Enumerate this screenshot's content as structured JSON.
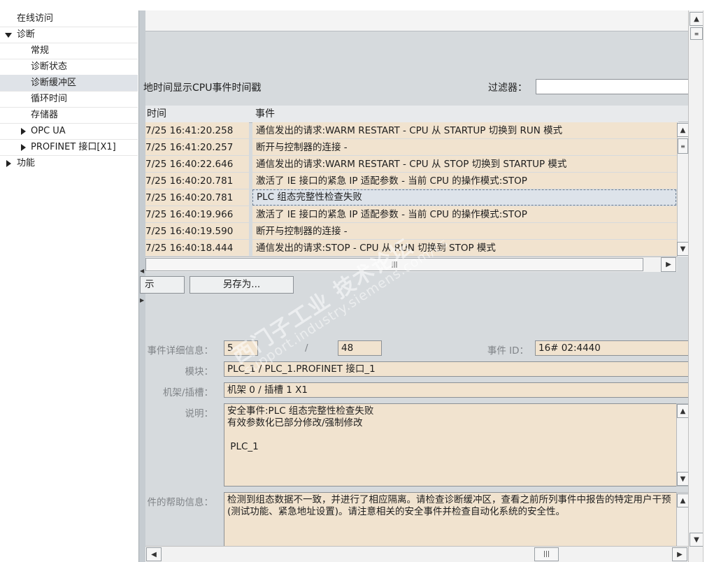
{
  "nav": {
    "items": [
      {
        "label": "在线访问",
        "level": 0,
        "expander": "none"
      },
      {
        "label": "诊断",
        "level": 0,
        "expander": "expanded"
      },
      {
        "label": "常规",
        "level": 1,
        "expander": "none"
      },
      {
        "label": "诊断状态",
        "level": 1,
        "expander": "none"
      },
      {
        "label": "诊断缓冲区",
        "level": 1,
        "expander": "none",
        "selected": true
      },
      {
        "label": "循环时间",
        "level": 1,
        "expander": "none"
      },
      {
        "label": "存储器",
        "level": 1,
        "expander": "none"
      },
      {
        "label": "OPC UA",
        "level": 1,
        "expander": "collapsed"
      },
      {
        "label": "PROFINET 接口[X1]",
        "level": 1,
        "expander": "collapsed"
      },
      {
        "label": "功能",
        "level": 0,
        "expander": "collapsed"
      }
    ]
  },
  "events": {
    "checkbox_text": "地时间显示CPU事件时间戳",
    "filter_label": "过滤器：",
    "filter_value": "",
    "col_time": "时间",
    "col_event": "事件",
    "rows": [
      {
        "time": "7/25 16:41:20.258",
        "event": "通信发出的请求:WARM RESTART  - CPU 从 STARTUP 切换到 RUN 模式"
      },
      {
        "time": "7/25 16:41:20.257",
        "event": "断开与控制器的连接 -"
      },
      {
        "time": "7/25 16:40:22.646",
        "event": "通信发出的请求:WARM RESTART  - CPU 从 STOP 切换到 STARTUP 模式"
      },
      {
        "time": "7/25 16:40:20.781",
        "event": "激活了 IE 接口的紧急 IP 适配参数 - 当前 CPU 的操作模式:STOP"
      },
      {
        "time": "7/25 16:40:20.781",
        "event": "PLC 组态完整性检查失败",
        "selected": true
      },
      {
        "time": "7/25 16:40:19.966",
        "event": "激活了 IE 接口的紧急 IP 适配参数 - 当前 CPU 的操作模式:STOP"
      },
      {
        "time": "7/25 16:40:19.590",
        "event": "断开与控制器的连接 -"
      },
      {
        "time": "7/25 16:40:18.444",
        "event": "通信发出的请求:STOP  - CPU 从 RUN 切换到 STOP 模式"
      }
    ],
    "hscroll_grip": "|||"
  },
  "buttons": {
    "display_partial": "示",
    "save_as": "另存为..."
  },
  "details": {
    "detail_label": "事件详细信息：",
    "detail_index": "5",
    "separator": "/",
    "detail_total": "48",
    "event_id_label": "事件 ID：",
    "event_id": "16# 02:4440",
    "module_label": "模块：",
    "module": "PLC_1 / PLC_1.PROFINET 接口_1",
    "rack_label": "机架/插槽：",
    "rack": "机架 0 / 插槽 1 X1",
    "desc_label": "说明：",
    "description": "安全事件:PLC 组态完整性检查失败\n有效参数化已部分修改/强制修改\n\n PLC_1",
    "help_label": "件的帮助信息：",
    "help": "检测到组态数据不一致，并进行了相应隔离。请检查诊断缓冲区，查看之前所列事件中报告的特定用户干预(测试功能、紧急地址设置)。请注意相关的安全事件并检查自动化系统的安全性。",
    "hscroll_grip": "|||"
  },
  "watermark": {
    "line1": "西门子工业  技术论坛",
    "line2": "support.industry.siemens.com/cs"
  },
  "icons": {
    "scroll_up": "chevron-up-icon",
    "scroll_down": "chevron-down-icon",
    "scroll_left": "chevron-left-icon",
    "scroll_right": "chevron-right-icon",
    "expanded": "triangle-down-icon",
    "collapsed": "triangle-right-icon"
  },
  "colors": {
    "row_bg": "#f1e3cf",
    "selected_row_bg": "#dde3ea",
    "pane_bg": "#d6dadd"
  }
}
